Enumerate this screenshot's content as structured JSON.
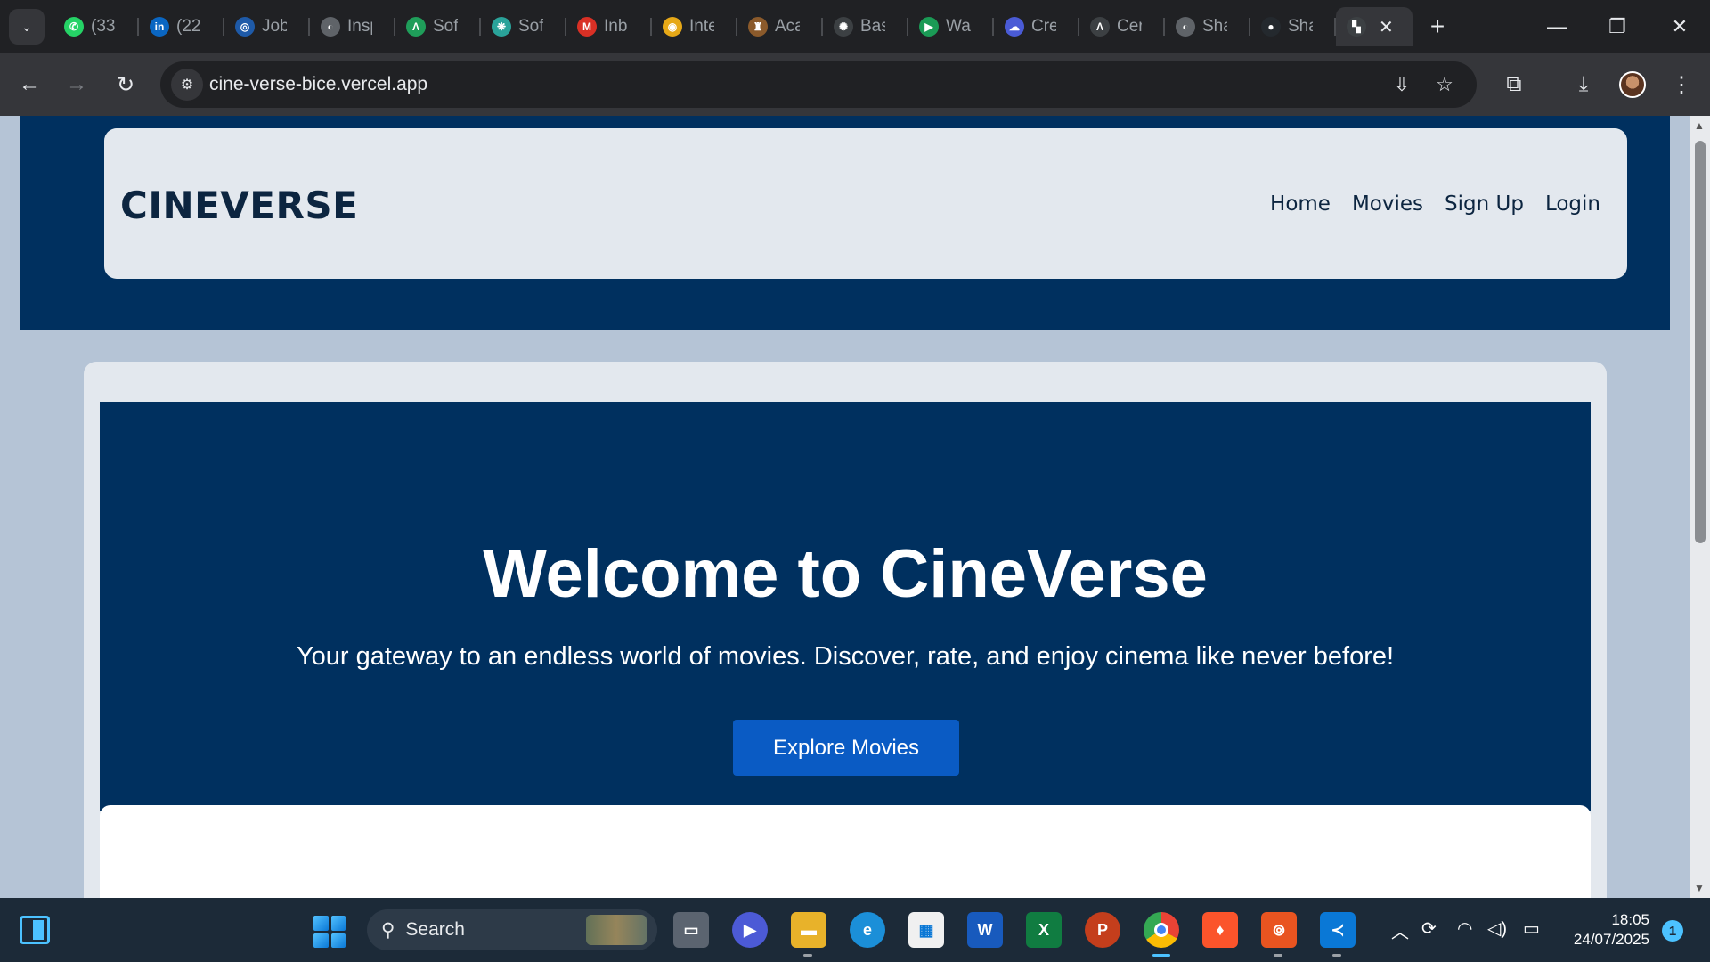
{
  "browser": {
    "tabs": [
      {
        "title": "(33",
        "icon": "whatsapp-icon",
        "color": "#25d366",
        "glyph": "✆"
      },
      {
        "title": "(22",
        "icon": "linkedin-icon",
        "color": "#0a66c2",
        "glyph": "in"
      },
      {
        "title": "Job",
        "icon": "un-globe-icon",
        "color": "#1e5aa8",
        "glyph": "◎"
      },
      {
        "title": "Insp",
        "icon": "globe-icon",
        "color": "#5f6368",
        "glyph": "◐"
      },
      {
        "title": "Sof",
        "icon": "arrow-logo-icon",
        "color": "#1f9e5a",
        "glyph": "Λ"
      },
      {
        "title": "Sof",
        "icon": "app-tile-icon",
        "color": "#2aa39a",
        "glyph": "❋"
      },
      {
        "title": "Inb",
        "icon": "gmail-icon",
        "color": "#d93025",
        "glyph": "M"
      },
      {
        "title": "Inte",
        "icon": "badge-icon",
        "color": "#e6a817",
        "glyph": "◉"
      },
      {
        "title": "Aca",
        "icon": "crest-icon",
        "color": "#8b5a2b",
        "glyph": "♜"
      },
      {
        "title": "Bas",
        "icon": "openai-icon",
        "color": "#3c4043",
        "glyph": "✺"
      },
      {
        "title": "Wa",
        "icon": "play-icon",
        "color": "#1a9a55",
        "glyph": "▶"
      },
      {
        "title": "Cre",
        "icon": "cloud-icon",
        "color": "#4a5bd6",
        "glyph": "☁"
      },
      {
        "title": "Cer",
        "icon": "code-icon",
        "color": "#3c4043",
        "glyph": "Λ"
      },
      {
        "title": "Sha",
        "icon": "globe-icon",
        "color": "#5f6368",
        "glyph": "◐"
      },
      {
        "title": "Sha",
        "icon": "github-icon",
        "color": "#24292e",
        "glyph": "●"
      }
    ],
    "active_tab_icon": "clapperboard-icon",
    "url": "cine-verse-bice.vercel.app"
  },
  "site": {
    "brand": "CINEVERSE",
    "nav": [
      "Home",
      "Movies",
      "Sign Up",
      "Login"
    ],
    "hero": {
      "title": "Welcome to CineVerse",
      "subtitle": "Your gateway to an endless world of movies. Discover, rate, and enjoy cinema like never before!",
      "cta": "Explore Movies"
    },
    "colors": {
      "header_bg": "#00305f",
      "page_bg": "#b5c4d6",
      "cta": "#0a5bc4"
    }
  },
  "taskbar": {
    "search_label": "Search",
    "apps": [
      "task-view-icon",
      "zoom-icon",
      "file-explorer-icon",
      "edge-icon",
      "ms-store-icon",
      "word-icon",
      "excel-icon",
      "powerpoint-icon",
      "chrome-icon",
      "brave-icon",
      "ubuntu-icon",
      "vscode-icon"
    ],
    "time": "18:05",
    "date": "24/07/2025",
    "notifications": "1"
  }
}
